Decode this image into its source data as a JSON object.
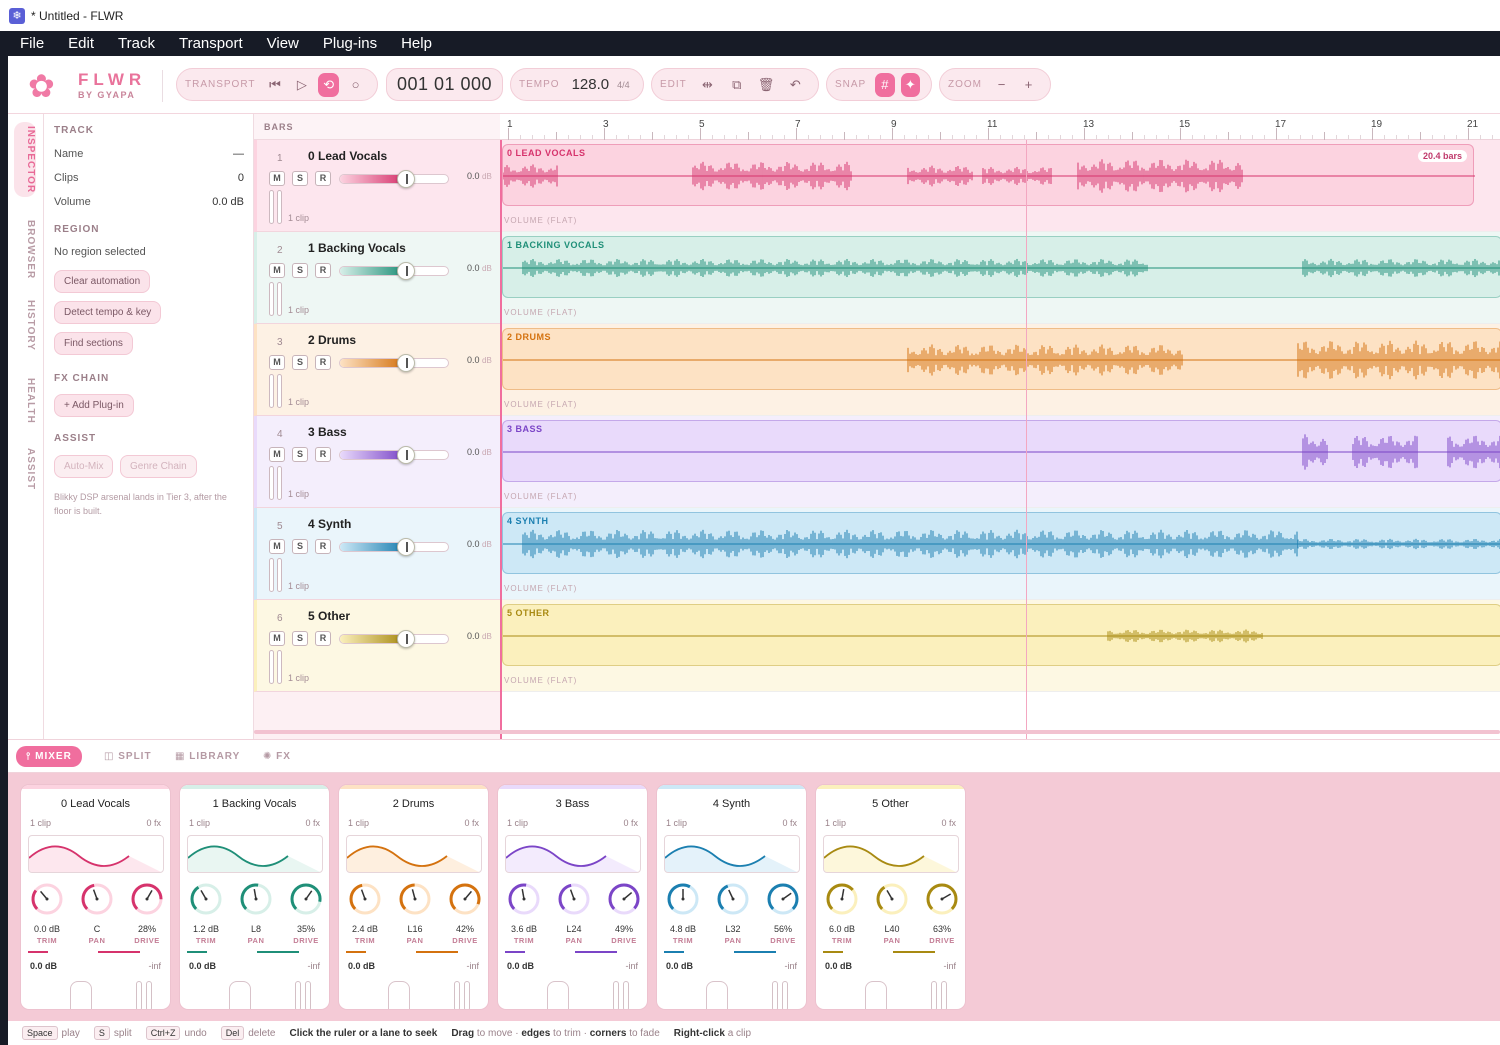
{
  "window": {
    "title": "* Untitled - FLWR"
  },
  "menu": [
    "File",
    "Edit",
    "Track",
    "Transport",
    "View",
    "Plug-ins",
    "Help"
  ],
  "brand": {
    "name": "FLWR",
    "by": "BY GYAPA"
  },
  "toolbar": {
    "transport_label": "TRANSPORT",
    "time": "001 01 000",
    "tempo_label": "TEMPO",
    "tempo": "128.0",
    "meter": "4/4",
    "edit_label": "EDIT",
    "snap_label": "SNAP",
    "zoom_label": "ZOOM"
  },
  "sidetabs": [
    "INSPECTOR",
    "BROWSER",
    "HISTORY",
    "HEALTH",
    "ASSIST"
  ],
  "inspector": {
    "track_title": "TRACK",
    "name_label": "Name",
    "name_value": "—",
    "clips_label": "Clips",
    "clips_value": "0",
    "volume_label": "Volume",
    "volume_value": "0.0 dB",
    "region_title": "REGION",
    "region_text": "No region selected",
    "btn_clear": "Clear automation",
    "btn_detect": "Detect tempo & key",
    "btn_find": "Find sections",
    "fx_title": "FX CHAIN",
    "btn_add": "+ Add Plug-in",
    "assist_title": "ASSIST",
    "btn_automix": "Auto-Mix",
    "btn_genre": "Genre Chain",
    "note": "Blikky DSP arsenal lands in Tier 3, after the floor is built."
  },
  "bars_label": "BARS",
  "ruler": [
    "1",
    "3",
    "5",
    "7",
    "9",
    "11",
    "13",
    "15",
    "17",
    "19",
    "21"
  ],
  "tracks": [
    {
      "num": "1",
      "name": "0 Lead Vocals",
      "db": "0.0",
      "clips": "1 clip",
      "clip_label": "0 LEAD VOCALS",
      "color": "#d6336c",
      "bg": "#fde6ee",
      "lane": "#fcd3e0"
    },
    {
      "num": "2",
      "name": "1 Backing Vocals",
      "db": "0.0",
      "clips": "1 clip",
      "clip_label": "1 BACKING VOCALS",
      "color": "#1f8f78",
      "bg": "#eef7f4",
      "lane": "#d7efe8"
    },
    {
      "num": "3",
      "name": "2 Drums",
      "db": "0.0",
      "clips": "1 clip",
      "clip_label": "2 DRUMS",
      "color": "#d4720f",
      "bg": "#fdf1e4",
      "lane": "#fde2c4"
    },
    {
      "num": "4",
      "name": "3 Bass",
      "db": "0.0",
      "clips": "1 clip",
      "clip_label": "3 BASS",
      "color": "#7b45c7",
      "bg": "#f4eefc",
      "lane": "#e9dafb"
    },
    {
      "num": "5",
      "name": "4 Synth",
      "db": "0.0",
      "clips": "1 clip",
      "clip_label": "4 SYNTH",
      "color": "#1b7fb0",
      "bg": "#eaf5fb",
      "lane": "#cde8f6"
    },
    {
      "num": "6",
      "name": "5 Other",
      "db": "0.0",
      "clips": "1 clip",
      "clip_label": "5 OTHER",
      "color": "#a88a12",
      "bg": "#fdf8e3",
      "lane": "#fbf0bd"
    }
  ],
  "lead_bars": "20.4 bars",
  "volume_flat": "VOLUME (FLAT)",
  "db_unit": "dB",
  "mixtabs": [
    "MIXER",
    "SPLIT",
    "LIBRARY",
    "FX"
  ],
  "strips": [
    {
      "name": "0 Lead Vocals",
      "clips": "1 clip",
      "fx": "0 fx",
      "trim": "0.0 dB",
      "pan": "C",
      "drive": "28%",
      "out": "0.0 dB",
      "inf": "-inf"
    },
    {
      "name": "1 Backing Vocals",
      "clips": "1 clip",
      "fx": "0 fx",
      "trim": "1.2 dB",
      "pan": "L8",
      "drive": "35%",
      "out": "0.0 dB",
      "inf": "-inf"
    },
    {
      "name": "2 Drums",
      "clips": "1 clip",
      "fx": "0 fx",
      "trim": "2.4 dB",
      "pan": "L16",
      "drive": "42%",
      "out": "0.0 dB",
      "inf": "-inf"
    },
    {
      "name": "3 Bass",
      "clips": "1 clip",
      "fx": "0 fx",
      "trim": "3.6 dB",
      "pan": "L24",
      "drive": "49%",
      "out": "0.0 dB",
      "inf": "-inf"
    },
    {
      "name": "4 Synth",
      "clips": "1 clip",
      "fx": "0 fx",
      "trim": "4.8 dB",
      "pan": "L32",
      "drive": "56%",
      "out": "0.0 dB",
      "inf": "-inf"
    },
    {
      "name": "5 Other",
      "clips": "1 clip",
      "fx": "0 fx",
      "trim": "6.0 dB",
      "pan": "L40",
      "drive": "63%",
      "out": "0.0 dB",
      "inf": "-inf"
    }
  ],
  "knob_labels": {
    "trim": "TRIM",
    "pan": "PAN",
    "drive": "DRIVE"
  },
  "status": {
    "k1": "Space",
    "t1": "play",
    "k2": "S",
    "t2": "split",
    "k3": "Ctrl+Z",
    "t3": "undo",
    "k4": "Del",
    "t4": "delete",
    "h1": "Click the ruler or a lane to seek",
    "h2a": "Drag",
    "h2b": "to move ·",
    "h2c": "edges",
    "h2d": "to trim ·",
    "h2e": "corners",
    "h2f": "to fade",
    "h3a": "Right-click",
    "h3b": "a clip"
  }
}
